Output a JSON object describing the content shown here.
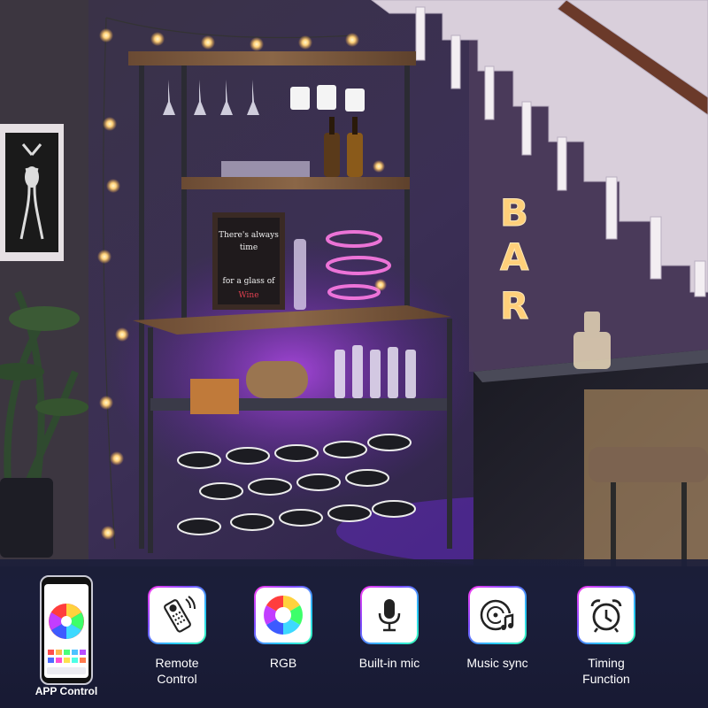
{
  "scene": {
    "sign_letters": [
      "B",
      "A",
      "R"
    ],
    "chalkboard_text": "There's always time for a glass of Wine"
  },
  "features": [
    {
      "label": "APP Control",
      "icon": "smartphone-app-icon"
    },
    {
      "label": "Remote\nControl",
      "icon": "remote-control-icon"
    },
    {
      "label": "RGB",
      "icon": "rgb-color-wheel-icon"
    },
    {
      "label": "Built-in mic",
      "icon": "microphone-icon"
    },
    {
      "label": "Music sync",
      "icon": "music-sync-icon"
    },
    {
      "label": "Timing\nFunction",
      "icon": "alarm-clock-icon"
    }
  ],
  "colors": {
    "led_purple": "#9b3dff",
    "led_pink": "#ff4fd8",
    "panel_bg": "#1b1e3a",
    "tile_gradient": [
      "#ff3df0",
      "#7c4dff",
      "#26c6ff",
      "#3dffb4"
    ]
  }
}
